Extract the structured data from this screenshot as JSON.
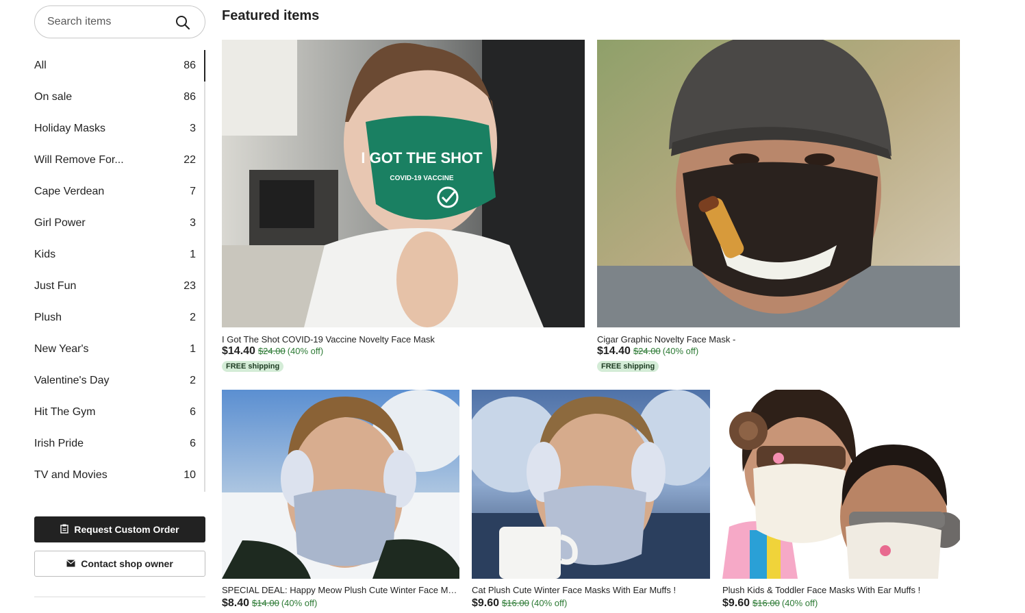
{
  "search": {
    "placeholder": "Search items"
  },
  "categories": [
    {
      "label": "All",
      "count": "86"
    },
    {
      "label": "On sale",
      "count": "86"
    },
    {
      "label": "Holiday Masks",
      "count": "3"
    },
    {
      "label": "Will Remove For...",
      "count": "22"
    },
    {
      "label": "Cape Verdean",
      "count": "7"
    },
    {
      "label": "Girl Power",
      "count": "3"
    },
    {
      "label": "Kids",
      "count": "1"
    },
    {
      "label": "Just Fun",
      "count": "23"
    },
    {
      "label": "Plush",
      "count": "2"
    },
    {
      "label": "New Year's",
      "count": "1"
    },
    {
      "label": "Valentine's Day",
      "count": "2"
    },
    {
      "label": "Hit The Gym",
      "count": "6"
    },
    {
      "label": "Irish Pride",
      "count": "6"
    },
    {
      "label": "TV and Movies",
      "count": "10"
    }
  ],
  "buttons": {
    "custom_order": "Request Custom Order",
    "contact_owner": "Contact shop owner"
  },
  "featured": {
    "title": "Featured items",
    "items": [
      {
        "title": "I Got The Shot COVID-19 Vaccine Novelty Face Mask",
        "price": "$14.40",
        "original": "$24.00",
        "discount": "(40% off)",
        "badge": "FREE shipping",
        "mask_text": "I GOT THE SHOT",
        "mask_subtext": "COVID-19 VACCINE"
      },
      {
        "title": "Cigar Graphic Novelty Face Mask -",
        "price": "$14.40",
        "original": "$24.00",
        "discount": "(40% off)",
        "badge": "FREE shipping"
      },
      {
        "title": "SPECIAL DEAL: Happy Meow Plush Cute Winter Face Masks With Ear Muffs !",
        "price": "$8.40",
        "original": "$14.00",
        "discount": "(40% off)"
      },
      {
        "title": "Cat Plush Cute Winter Face Masks With Ear Muffs !",
        "price": "$9.60",
        "original": "$16.00",
        "discount": "(40% off)"
      },
      {
        "title": "Plush Kids & Toddler Face Masks With Ear Muffs !",
        "price": "$9.60",
        "original": "$16.00",
        "discount": "(40% off)"
      }
    ]
  },
  "icons": {
    "search": "search-icon",
    "custom_order": "clipboard-icon",
    "contact": "envelope-icon"
  },
  "colors": {
    "primary_button": "#222222",
    "sale_text": "#2c7a34",
    "badge_bg": "#d4ecd7"
  }
}
